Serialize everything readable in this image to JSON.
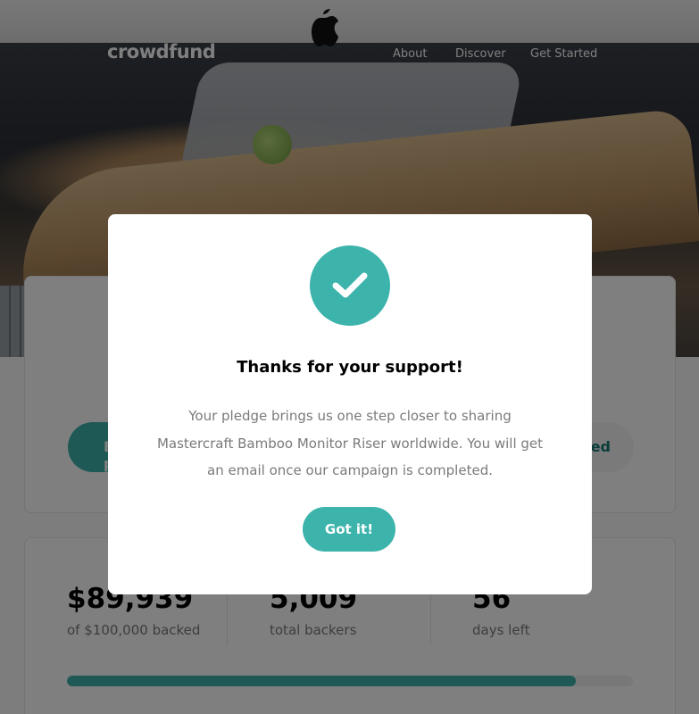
{
  "header": {
    "logo": "crowdfund",
    "nav": [
      "About",
      "Discover",
      "Get Started"
    ]
  },
  "project": {
    "back_label": "Back this project",
    "bookmark_label": "Bookmarked"
  },
  "stats": {
    "backed_value": "$89,939",
    "backed_label": "of $100,000 backed",
    "backers_value": "5,009",
    "backers_label": "total backers",
    "days_value": "56",
    "days_label": "days left",
    "progress_fraction": 0.899
  },
  "modal": {
    "title": "Thanks for your support!",
    "body": "Your pledge brings us one step closer to sharing Mastercraft Bamboo Monitor Riser worldwide. You will get an email once our campaign is completed.",
    "button_label": "Got it!"
  },
  "colors": {
    "accent": "#3cb3ab",
    "accent_dark": "#147b74",
    "overlay": "rgba(0,0,0,0.5)"
  }
}
